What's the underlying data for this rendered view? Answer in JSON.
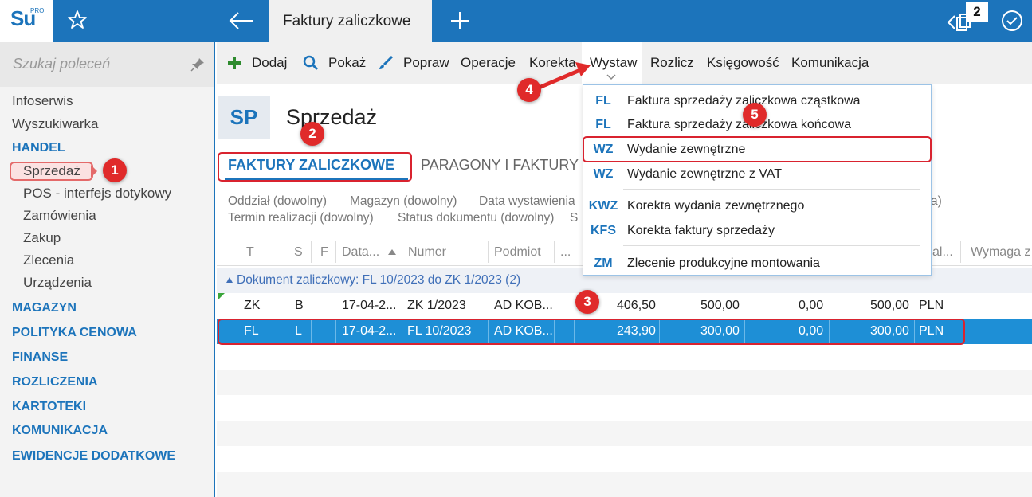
{
  "app": {
    "logo_text": "Su",
    "logo_sup": "PRO",
    "active_tab": "Faktury zaliczkowe",
    "window_count": "2"
  },
  "sidebar": {
    "search_placeholder": "Szukaj poleceń",
    "items": [
      {
        "label": "Infoserwis",
        "type": "item"
      },
      {
        "label": "Wyszukiwarka",
        "type": "item"
      },
      {
        "label": "HANDEL",
        "type": "section"
      },
      {
        "label": "Sprzedaż",
        "type": "sub"
      },
      {
        "label": "POS - interfejs dotykowy",
        "type": "sub"
      },
      {
        "label": "Zamówienia",
        "type": "sub"
      },
      {
        "label": "Zakup",
        "type": "sub"
      },
      {
        "label": "Zlecenia",
        "type": "sub"
      },
      {
        "label": "Urządzenia",
        "type": "sub"
      },
      {
        "label": "MAGAZYN",
        "type": "section"
      },
      {
        "label": "POLITYKA CENOWA",
        "type": "section"
      },
      {
        "label": "FINANSE",
        "type": "section"
      },
      {
        "label": "ROZLICZENIA",
        "type": "section"
      },
      {
        "label": "KARTOTEKI",
        "type": "section"
      },
      {
        "label": "KOMUNIKACJA",
        "type": "section"
      },
      {
        "label": "EWIDENCJE DODATKOWE",
        "type": "section"
      }
    ]
  },
  "toolbar": {
    "dodaj": "Dodaj",
    "pokaz": "Pokaż",
    "popraw": "Popraw",
    "operacje": "Operacje",
    "korekta": "Korekta",
    "wystaw": "Wystaw",
    "rozlicz": "Rozlicz",
    "ksiegowosc": "Księgowość",
    "komunikacja": "Komunikacja"
  },
  "header": {
    "badge": "SP",
    "title": "Sprzedaż"
  },
  "tabs": {
    "active": "FAKTURY ZALICZKOWE",
    "other": "PARAGONY I FAKTURY"
  },
  "filters": {
    "oddzial": "Oddział (dowolny)",
    "magazyn": "Magazyn (dowolny)",
    "data": "Data wystawienia",
    "termin": "Termin realizacji (dowolny)",
    "status": "Status dokumentu (dowolny)",
    "s_cut": "S",
    "a_cut": "a)"
  },
  "grid": {
    "columns": {
      "t": "T",
      "s": "S",
      "f": "F",
      "data": "Data...",
      "numer": "Numer",
      "podmiot": "Podmiot",
      "more": "...",
      "wal": "al...",
      "wymaga": "Wymaga z"
    },
    "group": "Dokument zaliczkowy: FL 10/2023 do ZK 1/2023 (2)",
    "rows": [
      {
        "t": "ZK",
        "s": "B",
        "date": "17-04-2...",
        "numer": "ZK 1/2023",
        "podmiot": "AD KOB...",
        "netto": "406,50",
        "brutto": "500,00",
        "zero": "0,00",
        "wartosc": "500,00",
        "waluta": "PLN"
      },
      {
        "t": "FL",
        "s": "L",
        "date": "17-04-2...",
        "numer": "FL 10/2023",
        "podmiot": "AD KOB...",
        "netto": "243,90",
        "brutto": "300,00",
        "zero": "0,00",
        "wartosc": "300,00",
        "waluta": "PLN"
      }
    ]
  },
  "dropdown": [
    {
      "code": "FL",
      "label": "Faktura sprzedaży zaliczkowa cząstkowa"
    },
    {
      "code": "FL",
      "label": "Faktura sprzedaży zaliczkowa końcowa"
    },
    {
      "code": "WZ",
      "label": "Wydanie zewnętrzne"
    },
    {
      "code": "WZ",
      "label": "Wydanie zewnętrzne z VAT"
    },
    {
      "code": "KWZ",
      "label": "Korekta wydania zewnętrznego"
    },
    {
      "code": "KFS",
      "label": "Korekta faktury sprzedaży"
    },
    {
      "code": "ZM",
      "label": "Zlecenie produkcyjne montowania"
    }
  ],
  "annotations": [
    "1",
    "2",
    "3",
    "4",
    "5"
  ],
  "colors": {
    "brand_blue": "#1c74bb",
    "selection": "#1e8fd6",
    "annotation_red": "#e02a2a"
  }
}
